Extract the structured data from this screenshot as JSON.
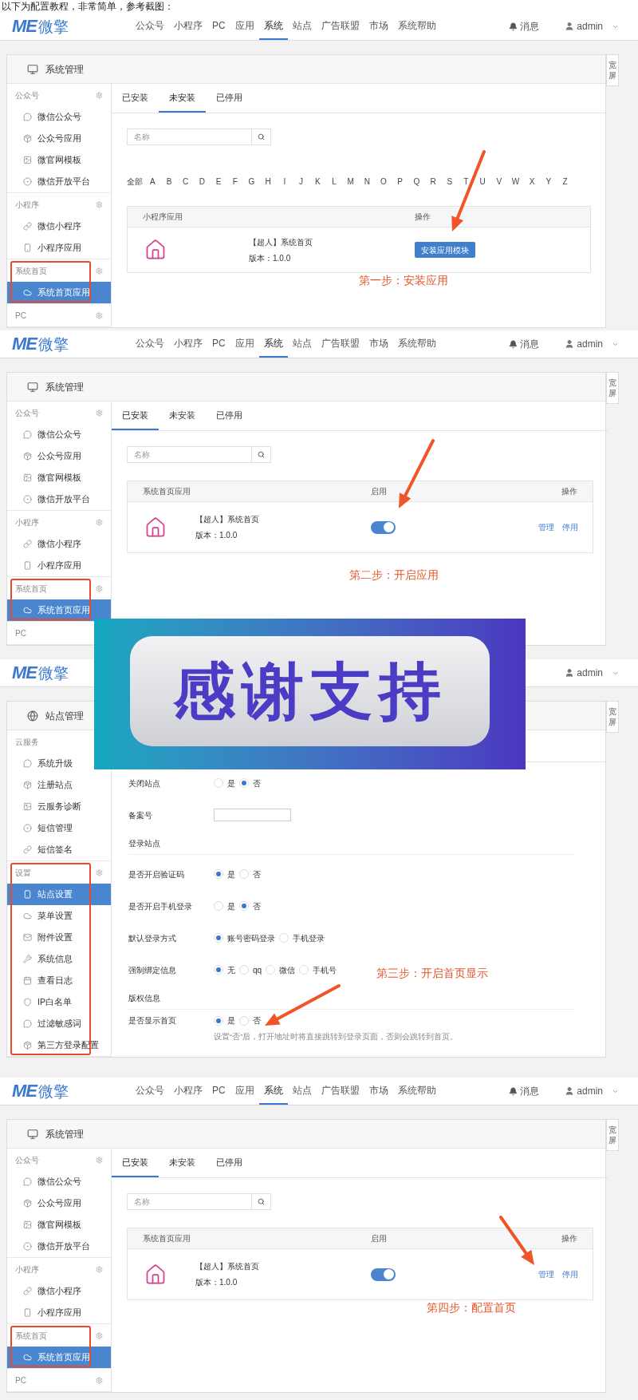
{
  "intro": "以下为配置教程，非常简单，参考截图：",
  "screens": [
    {
      "kind": "modules",
      "nav": {
        "logo_mark": "ME",
        "logo_text": "微擎",
        "items": [
          {
            "label": "公众号",
            "selected": false
          },
          {
            "label": "小程序",
            "selected": false
          },
          {
            "label": "PC",
            "selected": false
          },
          {
            "label": "应用",
            "selected": false
          },
          {
            "label": "系统",
            "selected": true
          },
          {
            "label": "站点",
            "selected": false
          },
          {
            "label": "广告联盟",
            "selected": false
          },
          {
            "label": "市场",
            "selected": false
          },
          {
            "label": "系统帮助",
            "selected": false
          }
        ],
        "messages": "消息",
        "user": "admin"
      },
      "wide_tab": "宽屏",
      "panel_title": "系统管理",
      "sidebar": [
        {
          "title": "公众号",
          "highlighted": false,
          "items": [
            {
              "label": "微信公众号",
              "selected": false
            },
            {
              "label": "公众号应用",
              "selected": false
            },
            {
              "label": "微官网模板",
              "selected": false
            },
            {
              "label": "微信开放平台",
              "selected": false
            }
          ]
        },
        {
          "title": "小程序",
          "highlighted": false,
          "items": [
            {
              "label": "微信小程序",
              "selected": false
            },
            {
              "label": "小程序应用",
              "selected": false
            }
          ]
        },
        {
          "title": "系统首页",
          "highlighted": true,
          "items": [
            {
              "label": "系统首页应用",
              "selected": true
            }
          ]
        },
        {
          "title": "PC",
          "highlighted": false
        }
      ],
      "tabs": [
        {
          "label": "已安装",
          "selected": false
        },
        {
          "label": "未安装",
          "selected": true
        },
        {
          "label": "已停用",
          "selected": false
        }
      ],
      "search_placeholder": "名称",
      "letters": [
        "全部",
        "A",
        "B",
        "C",
        "D",
        "E",
        "F",
        "G",
        "H",
        "I",
        "J",
        "K",
        "L",
        "M",
        "N",
        "O",
        "P",
        "Q",
        "R",
        "S",
        "T",
        "U",
        "V",
        "W",
        "X",
        "Y",
        "Z"
      ],
      "table": {
        "kind": "install",
        "columns": [
          "小程序应用",
          "操作"
        ],
        "rows": [
          {
            "name": "【超人】系统首页",
            "version": "版本：1.0.0",
            "button": "安装应用模块"
          }
        ]
      },
      "step": "第一步：安装应用"
    },
    {
      "kind": "modules",
      "nav": {
        "logo_mark": "ME",
        "logo_text": "微擎",
        "items": [
          {
            "label": "公众号",
            "selected": false
          },
          {
            "label": "小程序",
            "selected": false
          },
          {
            "label": "PC",
            "selected": false
          },
          {
            "label": "应用",
            "selected": false
          },
          {
            "label": "系统",
            "selected": true
          },
          {
            "label": "站点",
            "selected": false
          },
          {
            "label": "广告联盟",
            "selected": false
          },
          {
            "label": "市场",
            "selected": false
          },
          {
            "label": "系统帮助",
            "selected": false
          }
        ],
        "messages": "消息",
        "user": "admin"
      },
      "wide_tab": "宽屏",
      "panel_title": "系统管理",
      "sidebar": [
        {
          "title": "公众号",
          "highlighted": false,
          "items": [
            {
              "label": "微信公众号",
              "selected": false
            },
            {
              "label": "公众号应用",
              "selected": false
            },
            {
              "label": "微官网模板",
              "selected": false
            },
            {
              "label": "微信开放平台",
              "selected": false
            }
          ]
        },
        {
          "title": "小程序",
          "highlighted": false,
          "items": [
            {
              "label": "微信小程序",
              "selected": false
            },
            {
              "label": "小程序应用",
              "selected": false
            }
          ]
        },
        {
          "title": "系统首页",
          "highlighted": true,
          "items": [
            {
              "label": "系统首页应用",
              "selected": true
            }
          ]
        },
        {
          "title": "PC",
          "highlighted": false
        }
      ],
      "tabs": [
        {
          "label": "已安装",
          "selected": true
        },
        {
          "label": "未安装",
          "selected": false
        },
        {
          "label": "已停用",
          "selected": false
        }
      ],
      "search_placeholder": "名称",
      "table": {
        "kind": "installed",
        "columns": [
          "系统首页应用",
          "启用",
          "操作"
        ],
        "rows": [
          {
            "name": "【超人】系统首页",
            "version": "版本：1.0.0",
            "on": true,
            "actions": [
              "管理",
              "停用"
            ]
          }
        ]
      },
      "step": "第二步：开启应用"
    },
    {
      "kind": "settings",
      "nav": {
        "logo_mark": "ME",
        "logo_text": "微擎",
        "user": "admin"
      },
      "wide_tab": "宽屏",
      "panel_title": "站点管理",
      "sidebar": [
        {
          "title": "云服务",
          "highlighted": false,
          "items": [
            {
              "label": "系统升级",
              "selected": false
            },
            {
              "label": "注册站点",
              "selected": false
            },
            {
              "label": "云服务诊断",
              "selected": false
            },
            {
              "label": "短信管理",
              "selected": false
            },
            {
              "label": "短信签名",
              "selected": false
            }
          ]
        },
        {
          "title": "设置",
          "highlighted": true,
          "items": [
            {
              "label": "站点设置",
              "selected": true
            },
            {
              "label": "菜单设置",
              "selected": false
            },
            {
              "label": "附件设置",
              "selected": false
            },
            {
              "label": "系统信息",
              "selected": false
            },
            {
              "label": "查看日志",
              "selected": false
            },
            {
              "label": "IP白名单",
              "selected": false
            },
            {
              "label": "过滤敏感词",
              "selected": false
            },
            {
              "label": "第三方登录配置",
              "selected": false
            }
          ]
        }
      ],
      "form": [
        {
          "kind": "radio",
          "label": "关闭站点",
          "options": [
            {
              "label": "是",
              "selected": false
            },
            {
              "label": "否",
              "selected": true
            }
          ]
        },
        {
          "kind": "text_input",
          "label": "备案号"
        },
        {
          "kind": "section",
          "label": "登录站点"
        },
        {
          "kind": "radio",
          "label": "是否开启验证码",
          "options": [
            {
              "label": "是",
              "selected": true
            },
            {
              "label": "否",
              "selected": false
            }
          ]
        },
        {
          "kind": "radio",
          "label": "是否开启手机登录",
          "options": [
            {
              "label": "是",
              "selected": false
            },
            {
              "label": "否",
              "selected": true
            }
          ]
        },
        {
          "kind": "radio",
          "label": "默认登录方式",
          "options": [
            {
              "label": "账号密码登录",
              "selected": true
            },
            {
              "label": "手机登录",
              "selected": false
            }
          ]
        },
        {
          "kind": "radio",
          "label": "强制绑定信息",
          "options": [
            {
              "label": "无",
              "selected": true
            },
            {
              "label": "qq",
              "selected": false
            },
            {
              "label": "微信",
              "selected": false
            },
            {
              "label": "手机号",
              "selected": false
            }
          ]
        },
        {
          "kind": "section",
          "label": "版权信息"
        },
        {
          "kind": "radio",
          "label": "是否显示首页",
          "options": [
            {
              "label": "是",
              "selected": true
            },
            {
              "label": "否",
              "selected": false
            }
          ],
          "help": "设置“否”后，打开地址时将直接跳转到登录页面，否则会跳转到首页。"
        }
      ],
      "step": "第三步：开启首页显示"
    },
    {
      "kind": "modules",
      "nav": {
        "logo_mark": "ME",
        "logo_text": "微擎",
        "items": [
          {
            "label": "公众号",
            "selected": false
          },
          {
            "label": "小程序",
            "selected": false
          },
          {
            "label": "PC",
            "selected": false
          },
          {
            "label": "应用",
            "selected": false
          },
          {
            "label": "系统",
            "selected": true
          },
          {
            "label": "站点",
            "selected": false
          },
          {
            "label": "广告联盟",
            "selected": false
          },
          {
            "label": "市场",
            "selected": false
          },
          {
            "label": "系统帮助",
            "selected": false
          }
        ],
        "messages": "消息",
        "user": "admin"
      },
      "wide_tab": "宽屏",
      "panel_title": "系统管理",
      "sidebar": [
        {
          "title": "公众号",
          "highlighted": false,
          "items": [
            {
              "label": "微信公众号",
              "selected": false
            },
            {
              "label": "公众号应用",
              "selected": false
            },
            {
              "label": "微官网模板",
              "selected": false
            },
            {
              "label": "微信开放平台",
              "selected": false
            }
          ]
        },
        {
          "title": "小程序",
          "highlighted": false,
          "items": [
            {
              "label": "微信小程序",
              "selected": false
            },
            {
              "label": "小程序应用",
              "selected": false
            }
          ]
        },
        {
          "title": "系统首页",
          "highlighted": true,
          "items": [
            {
              "label": "系统首页应用",
              "selected": true
            }
          ]
        },
        {
          "title": "PC",
          "highlighted": false
        }
      ],
      "tabs": [
        {
          "label": "已安装",
          "selected": true
        },
        {
          "label": "未安装",
          "selected": false
        },
        {
          "label": "已停用",
          "selected": false
        }
      ],
      "search_placeholder": "名称",
      "table": {
        "kind": "installed",
        "columns": [
          "系统首页应用",
          "启用",
          "操作"
        ],
        "rows": [
          {
            "name": "【超人】系统首页",
            "version": "版本：1.0.0",
            "on": true,
            "actions": [
              "管理",
              "停用"
            ]
          }
        ]
      },
      "step": "第四步：配置首页"
    }
  ],
  "overlay_banner": {
    "text": "感谢支持"
  }
}
